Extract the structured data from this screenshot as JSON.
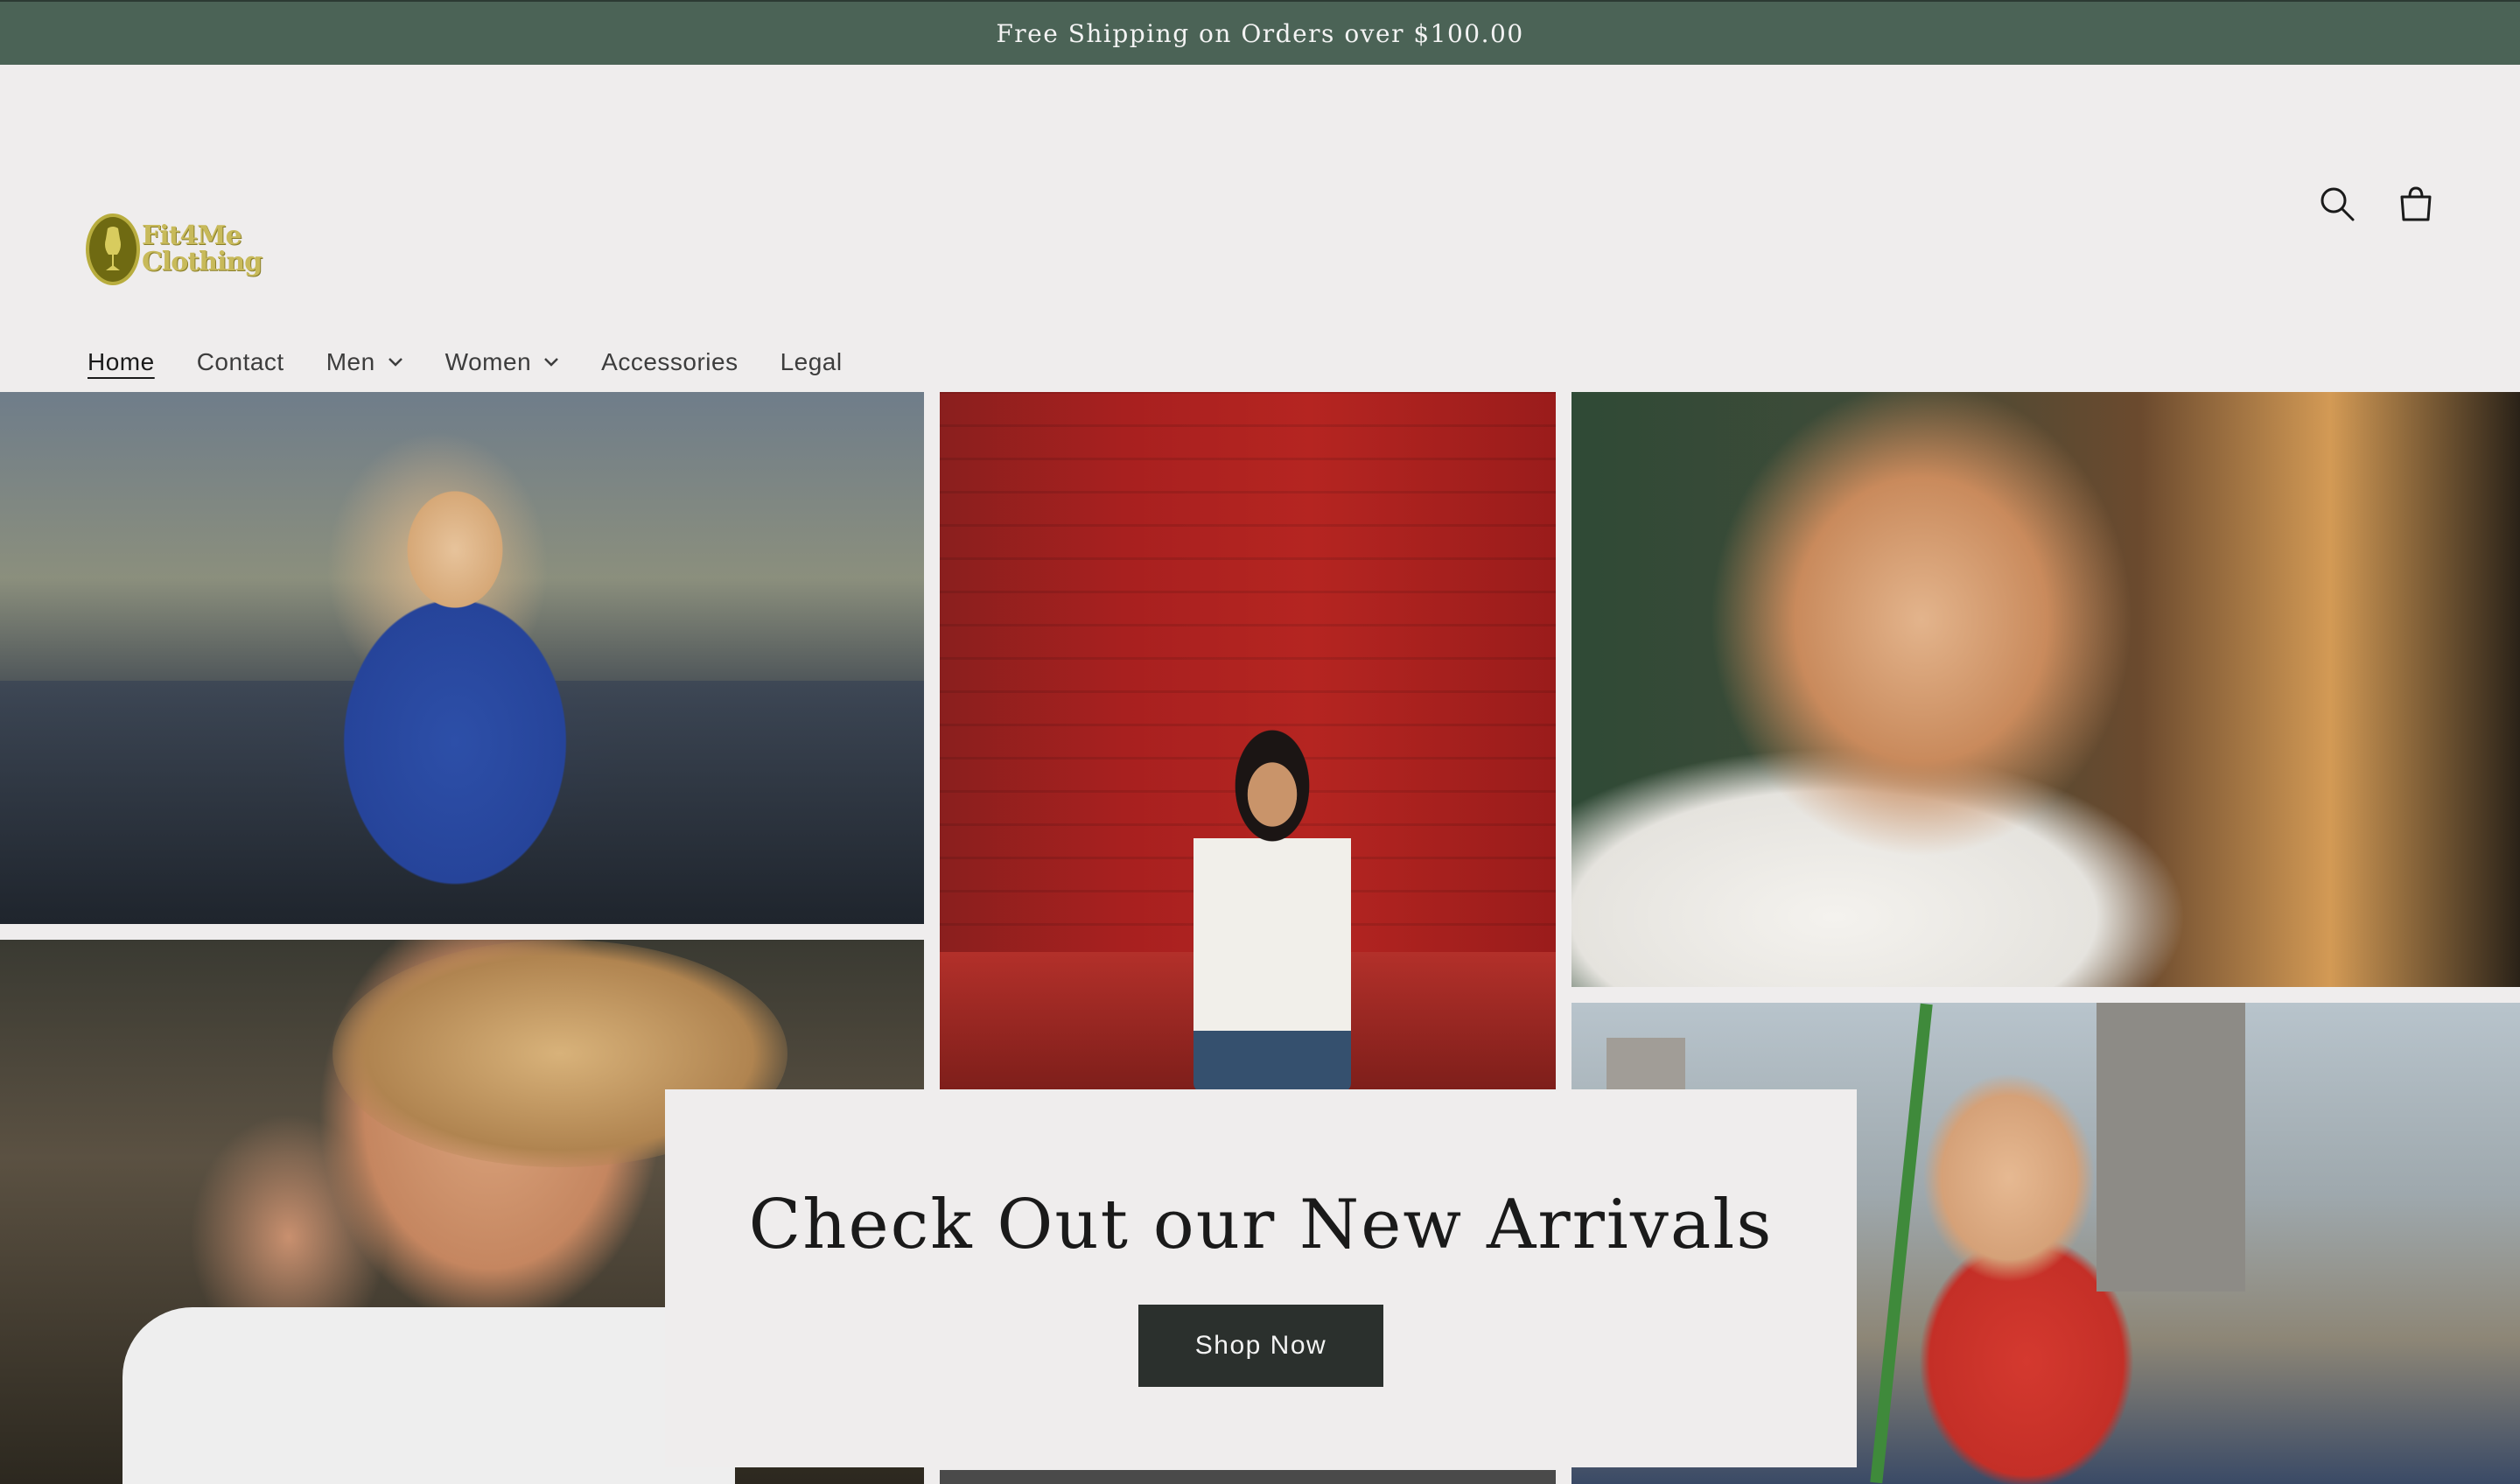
{
  "announcement": {
    "text": "Free Shipping on Orders over $100.00"
  },
  "header": {
    "logo": {
      "line1": "Fit4Me",
      "line2": "Clothing",
      "icon": "dress-form-icon"
    },
    "icons": {
      "search": "search-icon",
      "cart": "cart-icon"
    }
  },
  "nav": {
    "items": [
      {
        "label": "Home",
        "active": true
      },
      {
        "label": "Contact",
        "active": false
      },
      {
        "label": "Men",
        "active": false,
        "dropdown": true
      },
      {
        "label": "Women",
        "active": false,
        "dropdown": true
      },
      {
        "label": "Accessories",
        "active": false
      },
      {
        "label": "Legal",
        "active": false
      }
    ]
  },
  "hero": {
    "title": "Check Out our New Arrivals",
    "button_label": "Shop Now"
  },
  "colors": {
    "announcement_bg": "#4b6356",
    "page_bg": "#efeded",
    "button_bg": "#2b302d",
    "logo_accent": "#c8ba5a"
  }
}
